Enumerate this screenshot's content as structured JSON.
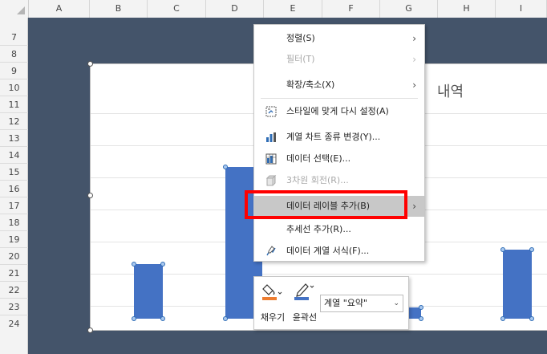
{
  "columns": [
    "A",
    "B",
    "C",
    "D",
    "E",
    "F",
    "G",
    "H",
    "I"
  ],
  "rows": [
    "7",
    "8",
    "9",
    "10",
    "11",
    "12",
    "13",
    "14",
    "15",
    "16",
    "17",
    "18",
    "19",
    "20",
    "21",
    "22",
    "23",
    "24"
  ],
  "chart": {
    "title_visible_fragment": "내역",
    "bars": [
      {
        "value": 0.26
      },
      {
        "value": 0.72
      },
      {
        "value": 0.055
      },
      {
        "value": 0.33
      }
    ],
    "bar_color": "#4472c4"
  },
  "context_menu": {
    "items": [
      {
        "label": "정렬(S)",
        "has_submenu": true,
        "disabled": false,
        "icon": ""
      },
      {
        "label": "필터(T)",
        "has_submenu": true,
        "disabled": true,
        "icon": ""
      },
      {
        "label": "확장/축소(X)",
        "has_submenu": true,
        "disabled": false,
        "icon": ""
      },
      {
        "label": "스타일에 맞게 다시 설정(A)",
        "has_submenu": false,
        "disabled": false,
        "icon": "reset-style-icon"
      },
      {
        "label": "계열 차트 종류 변경(Y)...",
        "has_submenu": false,
        "disabled": false,
        "icon": "change-chart-type-icon"
      },
      {
        "label": "데이터 선택(E)...",
        "has_submenu": false,
        "disabled": false,
        "icon": "select-data-icon"
      },
      {
        "label": "3차원 회전(R)...",
        "has_submenu": false,
        "disabled": true,
        "icon": "3d-rotation-icon"
      },
      {
        "label": "데이터 레이블 추가(B)",
        "has_submenu": true,
        "disabled": false,
        "icon": "",
        "highlighted": true
      },
      {
        "label": "추세선 추가(R)...",
        "has_submenu": false,
        "disabled": false,
        "icon": ""
      },
      {
        "label": "데이터 계열 서식(F)...",
        "has_submenu": false,
        "disabled": false,
        "icon": "format-series-icon"
      }
    ],
    "submenu_arrow": "›",
    "highlight_color": "#ff0000"
  },
  "format_toolbar": {
    "fill_label": "채우기",
    "outline_label": "윤곽선",
    "series_select_value": "계열 \"요약\"",
    "fill_color": "#ed7d31",
    "outline_color": "#4472c4"
  }
}
